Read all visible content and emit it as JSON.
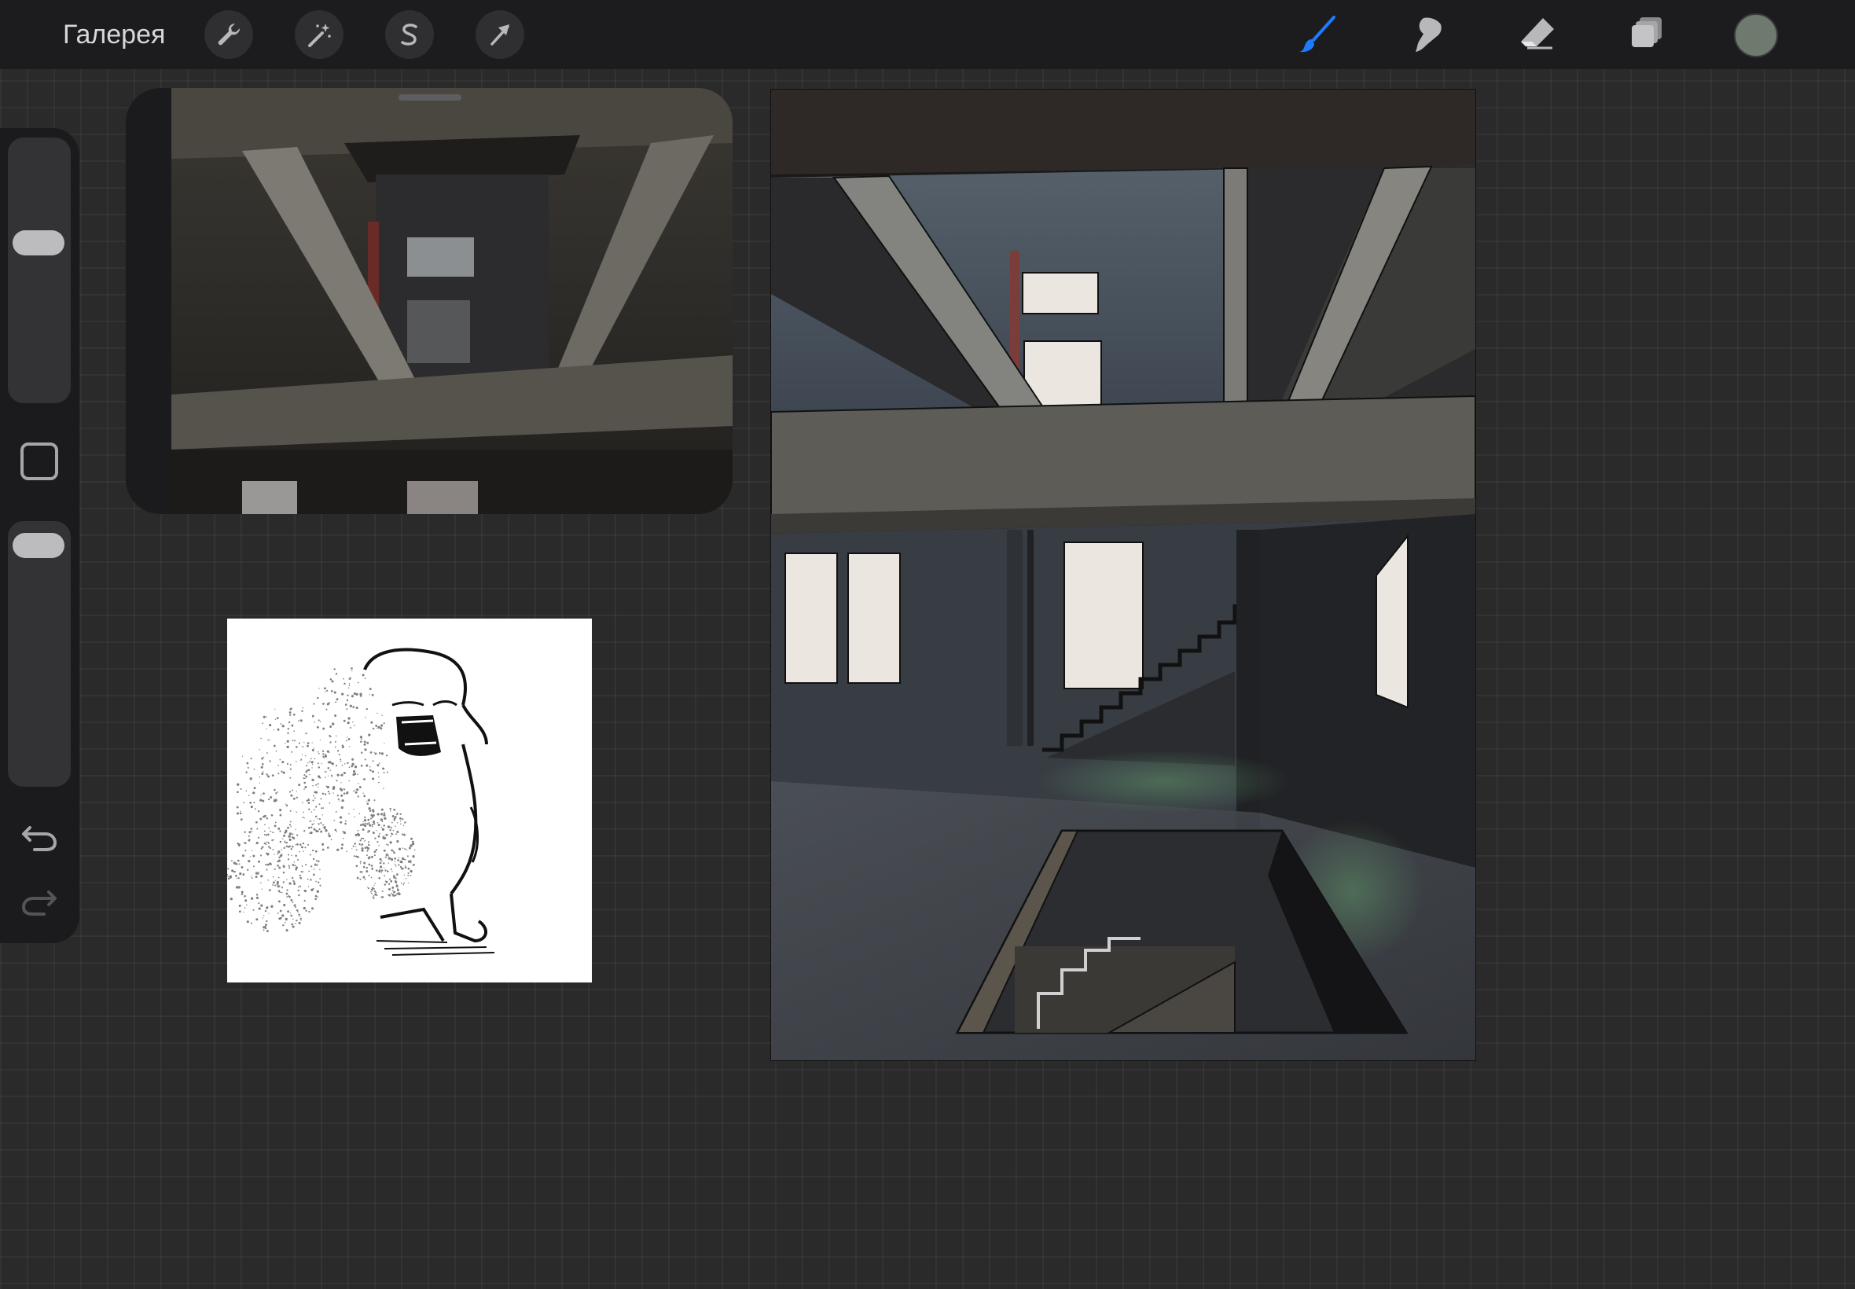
{
  "topbar": {
    "gallery_label": "Галерея",
    "actions": [
      "wrench-icon",
      "magic-wand-icon",
      "selection-s-icon",
      "move-arrow-icon"
    ],
    "tools": [
      {
        "name": "brush-icon",
        "active": true
      },
      {
        "name": "smudge-icon",
        "active": false
      },
      {
        "name": "eraser-icon",
        "active": false
      },
      {
        "name": "layers-icon",
        "active": false
      }
    ],
    "active_color": "#6f7a6f"
  },
  "sidebar": {
    "brush_size_level": 0.62,
    "opacity_level": 0.97,
    "modify_button": "square-modify-icon",
    "undo": "undo-icon",
    "redo": "redo-icon"
  },
  "colors": {
    "accent": "#1f7aff",
    "background": "#2a2a2b",
    "toolbar": "#1c1c1e",
    "icon": "#b8b8ba"
  }
}
